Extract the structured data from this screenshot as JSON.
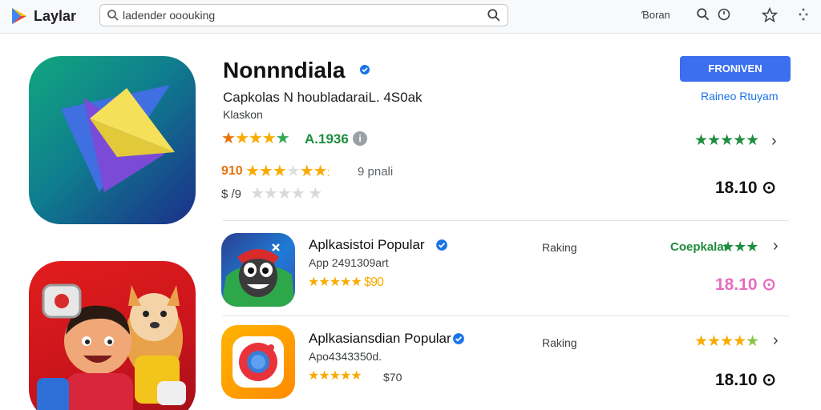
{
  "topbar": {
    "brand": "Laylar",
    "search_value": "ladender ooouking",
    "right_text": "Ɓoran"
  },
  "featured": {
    "title": "Nonnndiala",
    "subtitle": "Capkolas N houbladaraiL. 4S0ak",
    "subtitle2": "Klaskon",
    "rating_label": "A.1936",
    "info_icon": "i",
    "row2_num": "910",
    "row2_text": "9 pnali",
    "row3_num": "$ /9",
    "install_label": "FRONIVEN",
    "right_link": "Raineo Rtuyam",
    "price": "18.10 ⊙"
  },
  "apps": [
    {
      "name": "Aplkasistoi Popular",
      "sub": "App 2491309art",
      "rating_text": "★★★★★ $90",
      "ranking": "Raking",
      "right_label": "Coepkalar",
      "price": "18.10 ⊙",
      "price_color": "#e86cc0"
    },
    {
      "name": "Aplkasiansdian Popular",
      "sub": "Apo4343350d.",
      "rating_text": "$70",
      "ranking": "Raking",
      "price": "18.10 ⊙",
      "price_color": "#111111"
    }
  ],
  "colors": {
    "accent": "#3b6ff0",
    "star": "#f9ab00",
    "green": "#1e8e3e"
  }
}
